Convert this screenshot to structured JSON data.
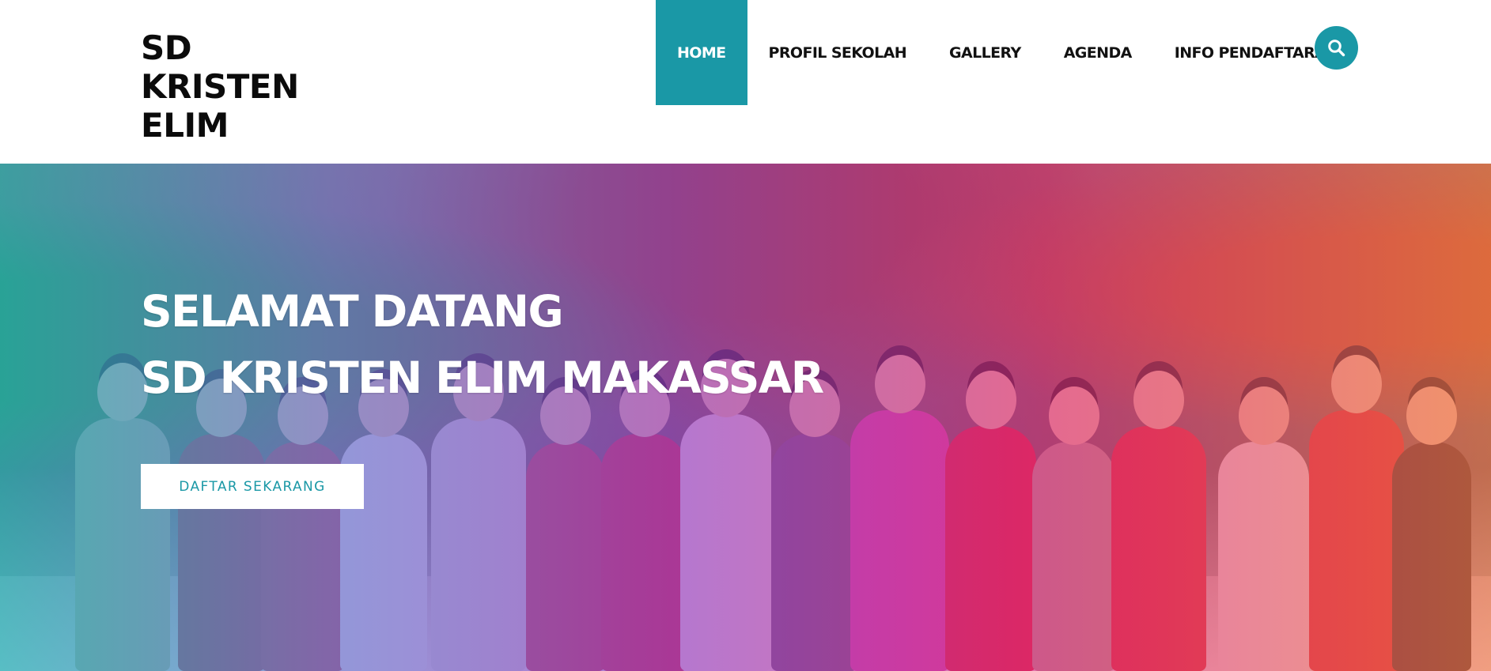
{
  "logo": {
    "lines": [
      "SD",
      "KRISTEN",
      "ELIM"
    ]
  },
  "nav": {
    "items": [
      {
        "label": "HOME",
        "active": true
      },
      {
        "label": "PROFIL SEKOLAH",
        "active": false
      },
      {
        "label": "GALLERY",
        "active": false
      },
      {
        "label": "AGENDA",
        "active": false
      },
      {
        "label": "INFO PENDAFTARAN",
        "active": false
      }
    ],
    "search_icon": "search-icon"
  },
  "hero": {
    "title_line_1": "SELAMAT DATANG",
    "title_line_2": "SD KRISTEN ELIM MAKASSAR",
    "cta_label": "DAFTAR SEKARANG",
    "background_image": "group photo of students in Christmas outfits with a teacher",
    "overlay_colors": [
      "#20b2ba",
      "#6e78d2",
      "#963cc8",
      "#e12882",
      "#f67846"
    ]
  },
  "colors": {
    "accent": "#1a98a6",
    "text_dark": "#111111",
    "white": "#ffffff"
  }
}
